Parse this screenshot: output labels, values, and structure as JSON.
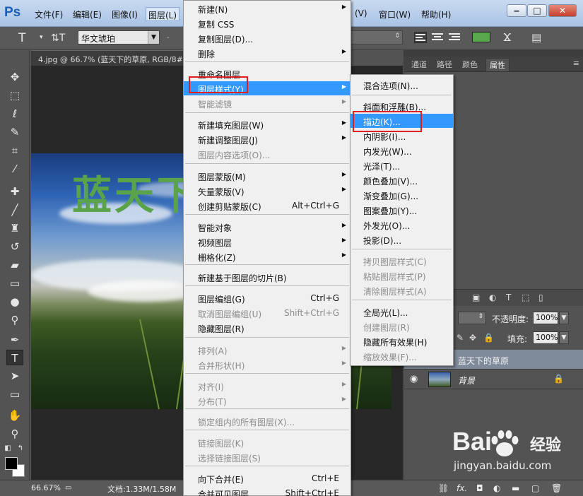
{
  "app": {
    "logo": "Ps",
    "menu": [
      "文件(F)",
      "编辑(E)",
      "图像(I)",
      "图层(L)",
      "(V)",
      "窗口(W)",
      "帮助(H)"
    ],
    "window_buttons": {
      "minimize": "‒",
      "restore": "□",
      "close": "✕"
    }
  },
  "options_bar": {
    "tool_glyph": "T",
    "orient_glyph": "⇅T",
    "font_family": "华文琥珀",
    "swatch_color": "#59a84e"
  },
  "document": {
    "tab_title": "4.jpg @ 66.7% (蓝天下的草原, RGB/8#",
    "overlay_text": "蓝天下",
    "zoom": "66.67%",
    "doc_info": "文档:1.33M/1.58M"
  },
  "panels": {
    "tabs": [
      "通道",
      "路径",
      "颜色",
      "属性"
    ],
    "opacity_label": "不透明度:",
    "opacity_value": "100%",
    "fill_label": "填充:",
    "fill_value": "100%",
    "layers": [
      {
        "name": "蓝天下的草原",
        "selected": true
      },
      {
        "name": "背景",
        "selected": false,
        "locked": true
      }
    ]
  },
  "context_menu": {
    "items": [
      {
        "label": "新建(N)",
        "arrow": true
      },
      {
        "label": "复制 CSS"
      },
      {
        "label": "复制图层(D)..."
      },
      {
        "label": "删除",
        "arrow": true
      },
      {
        "label": "重命名图层..."
      },
      {
        "label": "图层样式(Y)",
        "arrow": true,
        "highlight": true
      },
      {
        "label": "智能滤镜",
        "arrow": true,
        "disabled": true
      },
      {
        "label": "新建填充图层(W)",
        "arrow": true
      },
      {
        "label": "新建调整图层(J)",
        "arrow": true
      },
      {
        "label": "图层内容选项(O)...",
        "disabled": true
      },
      {
        "label": "图层蒙版(M)",
        "arrow": true
      },
      {
        "label": "矢量蒙版(V)",
        "arrow": true
      },
      {
        "label": "创建剪贴蒙版(C)",
        "shortcut": "Alt+Ctrl+G"
      },
      {
        "label": "智能对象",
        "arrow": true
      },
      {
        "label": "视频图层",
        "arrow": true
      },
      {
        "label": "栅格化(Z)",
        "arrow": true
      },
      {
        "label": "新建基于图层的切片(B)"
      },
      {
        "label": "图层编组(G)",
        "shortcut": "Ctrl+G"
      },
      {
        "label": "取消图层编组(U)",
        "shortcut": "Shift+Ctrl+G",
        "disabled": true
      },
      {
        "label": "隐藏图层(R)"
      },
      {
        "label": "排列(A)",
        "arrow": true,
        "disabled": true
      },
      {
        "label": "合并形状(H)",
        "arrow": true,
        "disabled": true
      },
      {
        "label": "对齐(I)",
        "arrow": true,
        "disabled": true
      },
      {
        "label": "分布(T)",
        "arrow": true,
        "disabled": true
      },
      {
        "label": "锁定组内的所有图层(X)...",
        "disabled": true
      },
      {
        "label": "链接图层(K)",
        "disabled": true
      },
      {
        "label": "选择链接图层(S)",
        "disabled": true
      },
      {
        "label": "向下合并(E)",
        "shortcut": "Ctrl+E"
      },
      {
        "label": "合并可见图层",
        "shortcut": "Shift+Ctrl+E"
      }
    ]
  },
  "submenu": {
    "items": [
      {
        "label": "混合选项(N)..."
      },
      {
        "label": "斜面和浮雕(B)..."
      },
      {
        "label": "描边(K)...",
        "highlight": true
      },
      {
        "label": "内阴影(I)..."
      },
      {
        "label": "内发光(W)..."
      },
      {
        "label": "光泽(T)..."
      },
      {
        "label": "颜色叠加(V)..."
      },
      {
        "label": "渐变叠加(G)..."
      },
      {
        "label": "图案叠加(Y)..."
      },
      {
        "label": "外发光(O)..."
      },
      {
        "label": "投影(D)..."
      },
      {
        "label": "拷贝图层样式(C)",
        "disabled": true
      },
      {
        "label": "粘贴图层样式(P)",
        "disabled": true
      },
      {
        "label": "清除图层样式(A)",
        "disabled": true
      },
      {
        "label": "全局光(L)..."
      },
      {
        "label": "创建图层(R)",
        "disabled": true
      },
      {
        "label": "隐藏所有效果(H)"
      },
      {
        "label": "缩放效果(F)...",
        "disabled": true
      }
    ]
  },
  "watermark": {
    "brand": "Bai",
    "brand2": "经验",
    "url": "jingyan.baidu.com"
  }
}
